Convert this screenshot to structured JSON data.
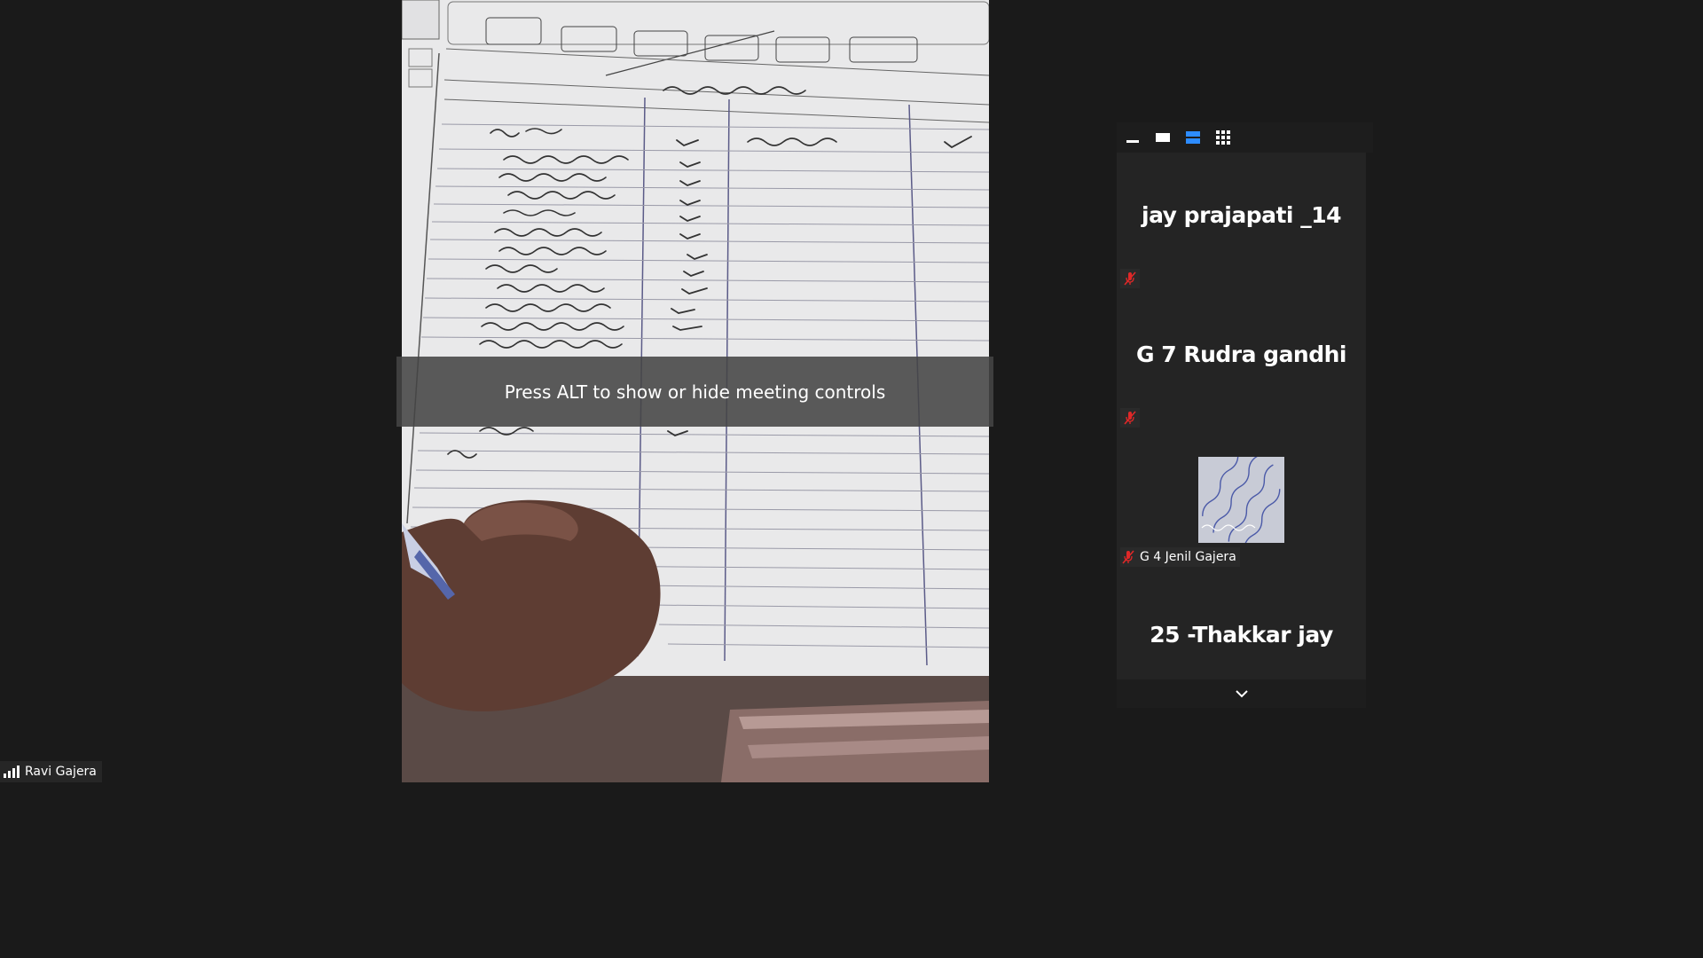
{
  "meeting": {
    "controls_hint": "Press ALT to show or hide meeting controls",
    "active_speaker": "Ravi Gajera"
  },
  "panel": {
    "view_modes": [
      "minimize-icon",
      "speaker-view-icon",
      "gallery-strip-icon",
      "gallery-grid-icon"
    ],
    "active_view": "gallery-strip-icon",
    "participants": [
      {
        "name": "jay prajapati _14",
        "muted": true,
        "video": false
      },
      {
        "name": "G 7 Rudra gandhi",
        "muted": true,
        "video": false
      },
      {
        "name": "G 4 Jenil Gajera",
        "muted": true,
        "video": true
      },
      {
        "name": "25 -Thakkar jay",
        "muted": true,
        "video": false
      }
    ],
    "more_icon": "chevron-down-icon"
  },
  "colors": {
    "background": "#1a1a1a",
    "accent": "#2d8cff",
    "muted_red": "#e02828"
  }
}
